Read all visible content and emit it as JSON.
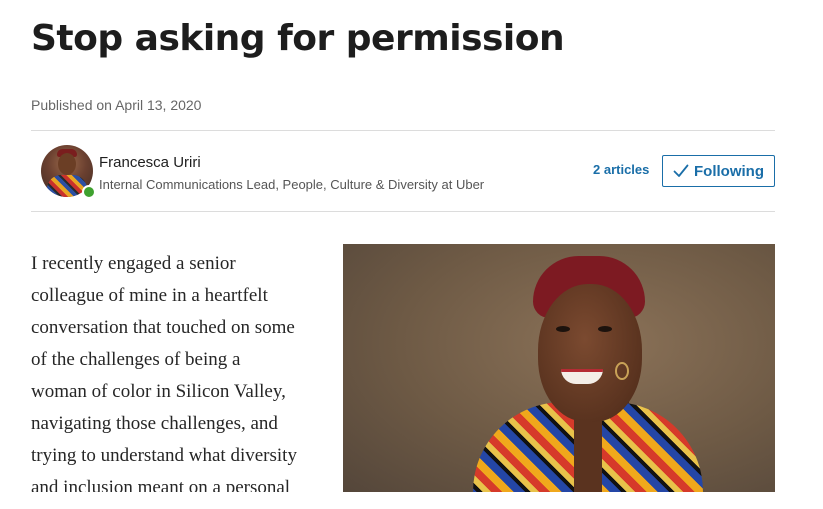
{
  "article": {
    "title": "Stop asking for permission",
    "published": "Published on April 13, 2020"
  },
  "author": {
    "name": "Francesca Uriri",
    "headline": "Internal Communications Lead, People, Culture & Diversity at Uber",
    "status": "online",
    "articles_link": "2 articles",
    "following_label": "Following"
  },
  "body": {
    "lines": [
      "I recently engaged a senior",
      "colleague of mine in a heartfelt",
      "conversation that touched on some",
      "of the challenges of being a",
      "woman of color in Silicon Valley,",
      "navigating those challenges, and",
      "trying to understand what diversity",
      "and inclusion meant on a personal"
    ]
  },
  "colors": {
    "accent": "#1a6ea8",
    "presence": "#3fa12f",
    "divider": "#dcdcdc"
  },
  "icons": {
    "follow": "check-icon",
    "presence": "online-status-icon"
  }
}
